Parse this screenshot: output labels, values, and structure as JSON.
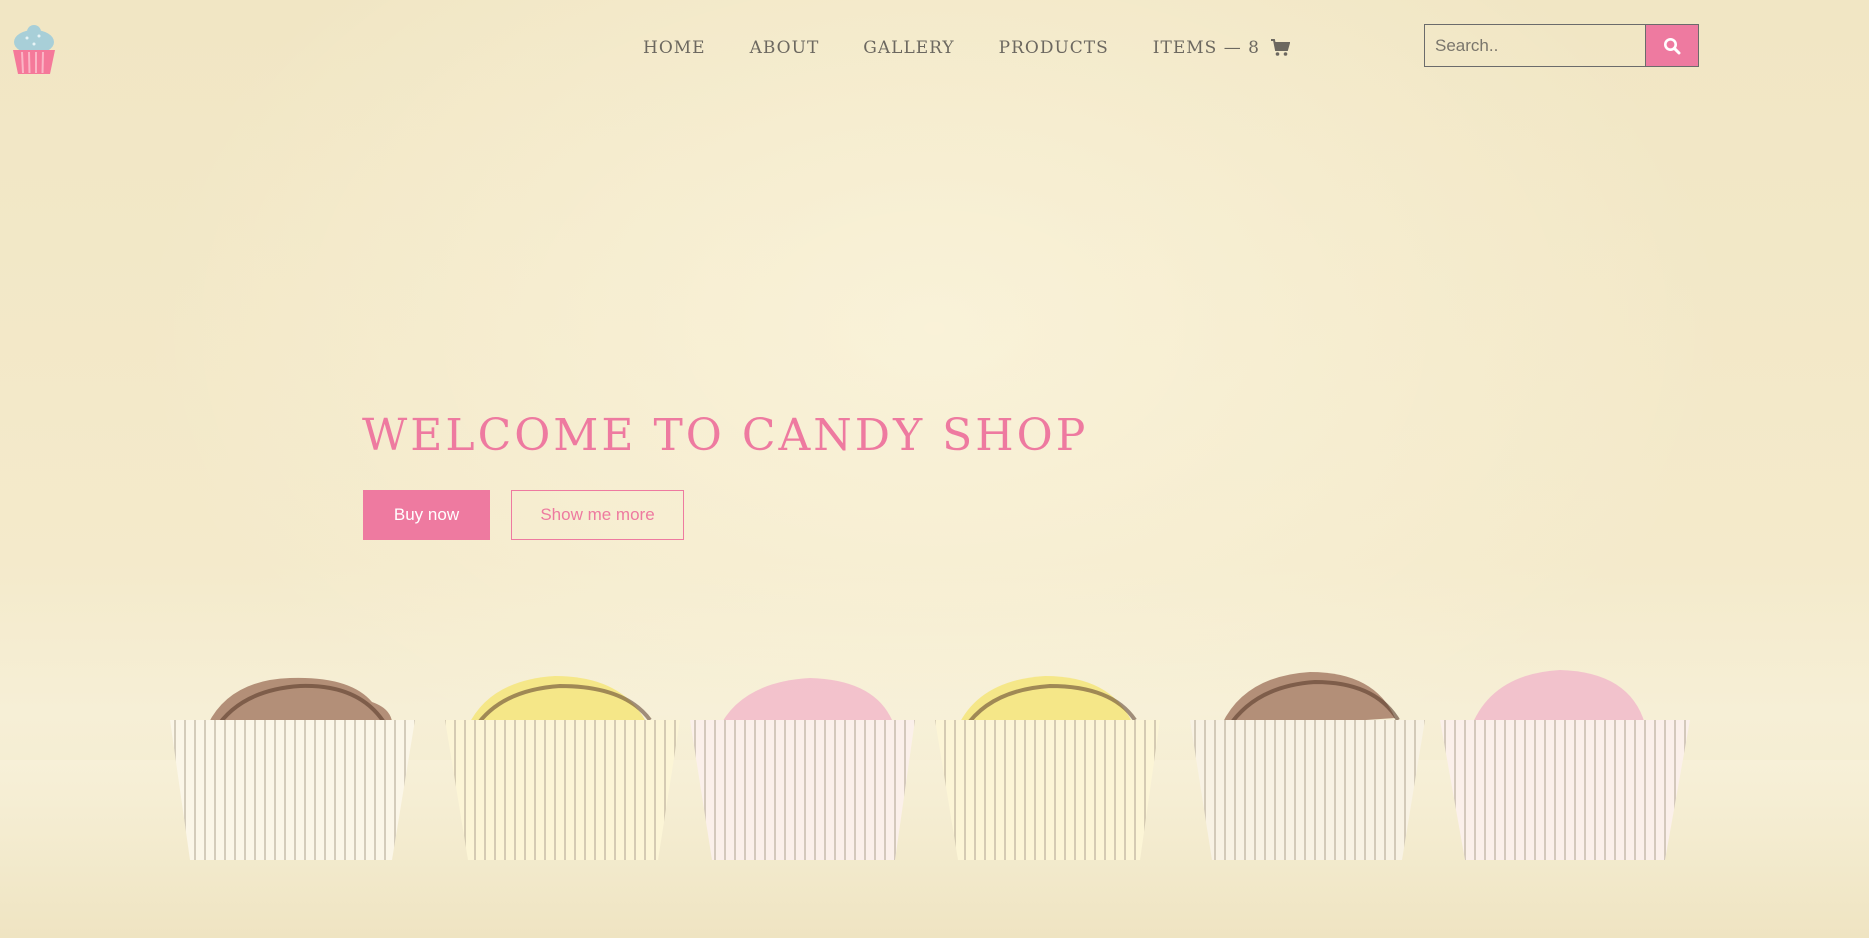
{
  "header": {
    "logo_icon": "cupcake-logo-icon",
    "nav": [
      {
        "label": "HOME"
      },
      {
        "label": "ABOUT"
      },
      {
        "label": "GALLERY"
      },
      {
        "label": "PRODUCTS"
      }
    ],
    "items_label": "ITEMS — 8",
    "cart_icon": "shopping-cart-icon",
    "search": {
      "placeholder": "Search..",
      "value": "",
      "button_icon": "search-icon"
    }
  },
  "hero": {
    "title": "WELCOME TO CANDY SHOP",
    "buy_label": "Buy now",
    "more_label": "Show me more",
    "background_image": "row of six cupcake candies (chocolate, lemon, strawberry, lemon, chocolate, strawberry)"
  },
  "colors": {
    "accent": "#ee7aa0",
    "background": "#f3e9c7",
    "nav_text": "#6c6860"
  }
}
